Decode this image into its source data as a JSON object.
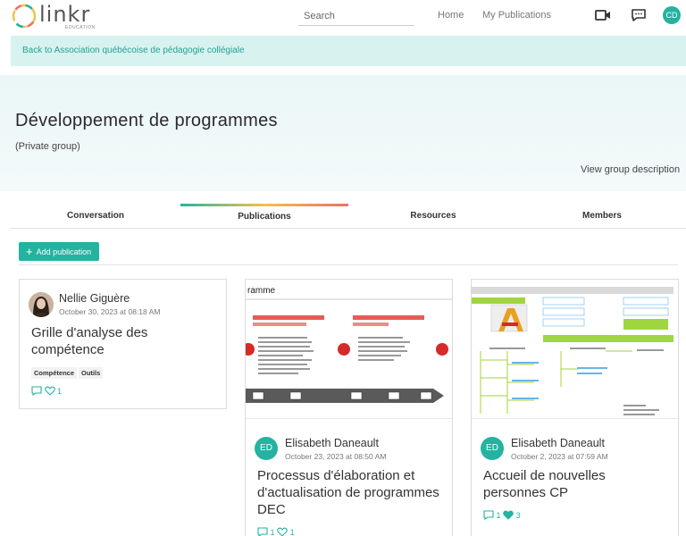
{
  "app": {
    "logo_text": "linkr",
    "logo_sub": "EDUCATION",
    "brand_color": "#23b3a0"
  },
  "topnav": {
    "search_placeholder": "Search",
    "home_label": "Home",
    "publications_label": "My Publications",
    "user_initials": "CD"
  },
  "back_link": "Back to Association québécoise de pédagogie collégiale",
  "group": {
    "title": "Développement de programmes",
    "privacy": "(Private group)",
    "view_description": "View group description"
  },
  "tabs": [
    {
      "label": "Conversation",
      "active": false
    },
    {
      "label": "Publications",
      "active": true
    },
    {
      "label": "Resources",
      "active": false
    },
    {
      "label": "Members",
      "active": false
    }
  ],
  "add_publication_label": "Add publication",
  "publications": [
    {
      "author": "Nellie Giguère",
      "date": "October 30, 2023 at 08:18 AM",
      "title": "Grille d'analyse des compétence",
      "tags": [
        "Compétence",
        "Outils"
      ],
      "likes": "1"
    },
    {
      "author": "Elisabeth Daneault",
      "author_initials": "ED",
      "date": "October 23, 2023 at 08:50 AM",
      "title": "Processus d'élaboration et d'actualisation de programmes DEC",
      "likes": "1",
      "thumb_heading": "ramme"
    },
    {
      "author": "Elisabeth Daneault",
      "author_initials": "ED",
      "date": "October 2, 2023 at 07:59 AM",
      "title": "Accueil de nouvelles personnes CP",
      "comments": "1",
      "likes": "3"
    }
  ]
}
